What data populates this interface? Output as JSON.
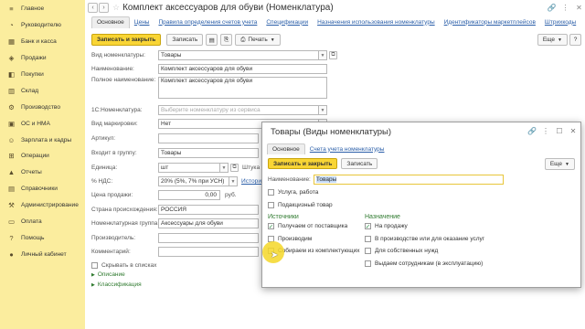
{
  "sidebar": {
    "items": [
      {
        "label": "Главное",
        "icon": "menu-icon"
      },
      {
        "label": "Руководителю",
        "icon": "chart-icon"
      },
      {
        "label": "Банк и касса",
        "icon": "bank-icon"
      },
      {
        "label": "Продажи",
        "icon": "sales-icon"
      },
      {
        "label": "Покупки",
        "icon": "cart-icon"
      },
      {
        "label": "Склад",
        "icon": "warehouse-icon"
      },
      {
        "label": "Производство",
        "icon": "production-icon"
      },
      {
        "label": "ОС и НМА",
        "icon": "assets-icon"
      },
      {
        "label": "Зарплата и кадры",
        "icon": "people-icon"
      },
      {
        "label": "Операции",
        "icon": "operations-icon"
      },
      {
        "label": "Отчеты",
        "icon": "reports-icon"
      },
      {
        "label": "Справочники",
        "icon": "catalog-icon"
      },
      {
        "label": "Администрирование",
        "icon": "admin-icon"
      },
      {
        "label": "Оплата",
        "icon": "payment-icon"
      },
      {
        "label": "Помощь",
        "icon": "help-icon"
      },
      {
        "label": "Личный кабинет",
        "icon": "account-icon"
      }
    ]
  },
  "window": {
    "title": "Комплект аксессуаров для обуви (Номенклатура)"
  },
  "tabs": [
    "Основное",
    "Цены",
    "Правила определения счетов учета",
    "Спецификации",
    "Назначения использования номенклатуры",
    "Идентификаторы маркетплейсов",
    "Штрихкоды"
  ],
  "toolbar": {
    "save_close": "Записать и закрыть",
    "save": "Записать",
    "print": "Печать",
    "more": "Еще"
  },
  "form": {
    "vid_label": "Вид номенклатуры:",
    "vid_value": "Товары",
    "name_label": "Наименование:",
    "name_value": "Комплект аксессуаров для обуви",
    "full_label": "Полное наименование:",
    "full_value": "Комплект аксессуаров для обуви",
    "n1c_label": "1С:Номенклатура:",
    "n1c_placeholder": "Выберите номенклатуру из сервиса",
    "marking_label": "Вид маркировки:",
    "marking_value": "Нет",
    "article_label": "Артикул:",
    "group_label": "Входит в группу:",
    "group_value": "Товары",
    "unit_label": "Единица:",
    "unit_value": "шт",
    "unit_extra": "Штука",
    "vat_label": "% НДС:",
    "vat_value": "20% (5%, 7% при УСН)",
    "vat_link": "История",
    "price_label": "Цена продажи:",
    "price_value": "0,00",
    "price_unit": "руб.",
    "country_label": "Страна происхождения:",
    "country_value": "РОССИЯ",
    "nomgroup_label": "Номенклатурная группа:",
    "nomgroup_value": "Аксессуары для обуви",
    "producer_label": "Производитель:",
    "comment_label": "Комментарий:",
    "hide_label": "Скрывать в списках",
    "sect_desc": "Описание",
    "sect_class": "Классификация"
  },
  "dialog": {
    "title": "Товары (Виды номенклатуры)",
    "tabs": [
      "Основное",
      "Счета учета номенклатуры"
    ],
    "save_close": "Записать и закрыть",
    "save": "Записать",
    "more": "Еще",
    "name_label": "Наименование:",
    "name_value": "Товары",
    "services": "Услуга, работа",
    "gift": "Подакцизный товар",
    "sources_title": "Источники",
    "src_supplier": "Получаем от поставщика",
    "src_produce": "Производим",
    "src_kit": "Собираем из комплектующих",
    "purpose_title": "Назначение",
    "p_sale": "На продажу",
    "p_production": "В производстве или для оказание услуг",
    "p_own": "Для собственных нужд",
    "p_staff": "Выдаем сотрудникам (в эксплуатацию)",
    "checked": "✓"
  }
}
